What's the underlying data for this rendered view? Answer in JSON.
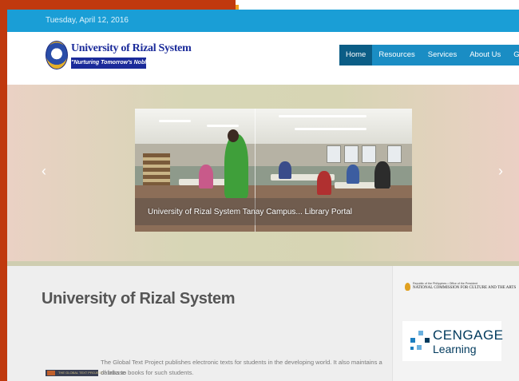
{
  "topbar": {
    "date": "Tuesday, April 12, 2016"
  },
  "logo": {
    "name": "University of Rizal System",
    "tagline": "\"Nurturing Tomorrow's Noblest\""
  },
  "nav": {
    "items": [
      "Home",
      "Resources",
      "Services",
      "About Us",
      "Gallery"
    ],
    "active": "Home"
  },
  "slider": {
    "caption": "University of Rizal System Tanay Campus... Library Portal",
    "prev_icon": "chevron-left-icon",
    "next_icon": "chevron-right-icon"
  },
  "main": {
    "title": "University of Rizal System",
    "thumb_text": "THE GLOBAL TEXT PROJECT",
    "description_line1": "The Global Text Project publishes electronic texts for students in the developing world. It also maintains a database",
    "description_line2": "of links to books for such students."
  },
  "sidebar": {
    "ncca_small": "Republic of the Philippines • Office of the President",
    "ncca_big": "NATIONAL COMMISSION FOR CULTURE AND THE ARTS",
    "cengage_word1": "CENGAGE",
    "cengage_word2": "Learning"
  },
  "colors": {
    "brand_blue": "#1a9ed6",
    "nav_blue": "#1a8dc4",
    "nav_active": "#0b5d86",
    "side_red": "#c0390e",
    "logo_navy": "#1b2b9a"
  }
}
